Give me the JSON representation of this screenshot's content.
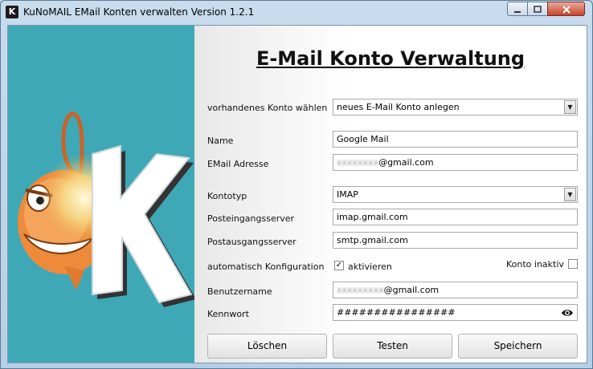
{
  "window": {
    "title": "KuNoMAIL EMail Konten verwalten Version 1.2.1",
    "app_icon_letter": "K"
  },
  "heading": "E-Mail Konto Verwaltung",
  "form": {
    "account_select_label": "vorhandenes Konto wählen",
    "account_select_value": "neues E-Mail Konto anlegen",
    "name_label": "Name",
    "name_value": "Google Mail",
    "email_label": "EMail Adresse",
    "email_blur": "xxxxxxxx",
    "email_domain": "@gmail.com",
    "type_label": "Kontotyp",
    "type_value": "IMAP",
    "incoming_label": "Posteingangsserver",
    "incoming_value": "imap.gmail.com",
    "outgoing_label": "Postausgangsserver",
    "outgoing_value": "smtp.gmail.com",
    "autoconfig_label": "automatisch Konfiguration",
    "autoconfig_checkbox_label": "aktivieren",
    "autoconfig_checked": true,
    "inactive_label": "Konto inaktiv",
    "inactive_checked": false,
    "username_label": "Benutzername",
    "username_blur": "xxxxxxxxx",
    "username_domain": "@gmail.com",
    "password_label": "Kennwort",
    "password_value": "################"
  },
  "buttons": {
    "delete": "Löschen",
    "test": "Testen",
    "save": "Speichern"
  },
  "logo_letter": "K",
  "colors": {
    "panel": "#3fa8b6",
    "close": "#c6432b"
  }
}
